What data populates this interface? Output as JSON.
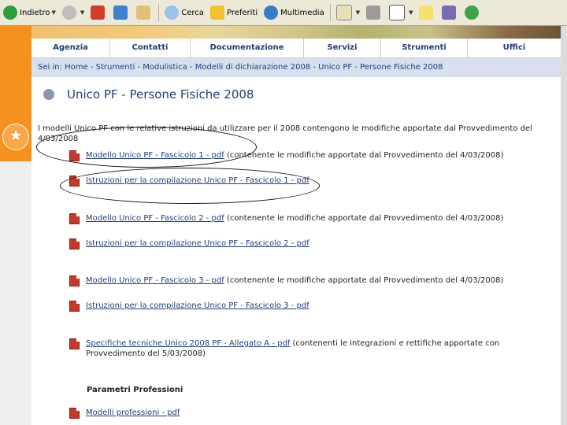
{
  "toolbar": {
    "back_label": "Indietro",
    "search_label": "Cerca",
    "favorites_label": "Preferiti",
    "media_label": "Multimedia"
  },
  "nav": {
    "items": [
      "Agenzia",
      "Contatti",
      "Documentazione",
      "Servizi",
      "Strumenti",
      "Uffici"
    ]
  },
  "breadcrumb": "Sei in: Home  -  Strumenti  -  Modulistica  -  Modelli di dichiarazione 2008  -  Unico PF - Persone Fisiche 2008",
  "page_title": "Unico PF - Persone Fisiche 2008",
  "intro": "I modelli Unico PF con le relative istruzioni da utilizzare per il 2008 contengono le modifiche apportate dal Provvedimento del 4/03/2008",
  "links": [
    {
      "link": "Modello Unico PF - Fascicolo 1 - pdf",
      "desc": " (contenente le modifiche apportate dal Provvedimento del 4/03/2008)"
    },
    {
      "link": "Istruzioni per la compilazione Unico PF - Fascicolo 1 - pdf",
      "desc": ""
    },
    {
      "link": "Modello Unico PF - Fascicolo 2 - pdf",
      "desc": " (contenente le modifiche apportate dal Provvedimento del 4/03/2008)"
    },
    {
      "link": "Istruzioni per la compilazione Unico PF - Fascicolo 2 - pdf",
      "desc": ""
    },
    {
      "link": "Modello Unico PF - Fascicolo 3 - pdf",
      "desc": " (contenente le modifiche apportate dal Provvedimento del 4/03/2008)"
    },
    {
      "link": "Istruzioni per la compilazione Unico PF - Fascicolo 3 - pdf",
      "desc": ""
    },
    {
      "link": "Specifiche tecniche Unico 2008 PF - Allegato A - pdf",
      "desc": " (contenenti le integrazioni e rettifiche apportate con",
      "desc2": "Provvedimento del 5/03/2008)"
    }
  ],
  "section_title": "Parametri Professioni",
  "last_link": "Modelli professioni - pdf",
  "colors": {
    "nav_text": "#1f3e7a",
    "crumb_bg": "#d6e0ee",
    "orange": "#f5921f"
  }
}
